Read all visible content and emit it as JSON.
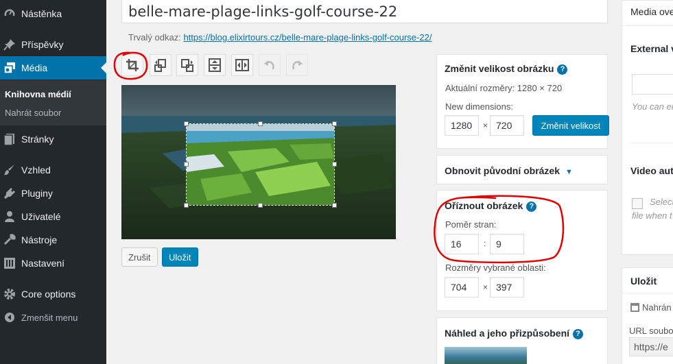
{
  "sidebar": {
    "items": [
      {
        "label": "Nástěnka",
        "icon": "dashboard-icon"
      },
      {
        "label": "Příspěvky",
        "icon": "pin-icon"
      },
      {
        "label": "Média",
        "icon": "media-icon"
      },
      {
        "label": "Stránky",
        "icon": "pages-icon"
      },
      {
        "label": "Vzhled",
        "icon": "appearance-icon"
      },
      {
        "label": "Pluginy",
        "icon": "plugins-icon"
      },
      {
        "label": "Uživatelé",
        "icon": "users-icon"
      },
      {
        "label": "Nástroje",
        "icon": "tools-icon"
      },
      {
        "label": "Nastavení",
        "icon": "settings-icon"
      },
      {
        "label": "Core options",
        "icon": "gear-icon"
      },
      {
        "label": "Zmenšit menu",
        "icon": "collapse-icon"
      }
    ],
    "submenu": [
      {
        "label": "Knihovna médií"
      },
      {
        "label": "Nahrát soubor"
      }
    ]
  },
  "editor": {
    "title": "belle-mare-plage-links-golf-course-22",
    "permalink_label": "Trvalý odkaz:",
    "permalink_url": "https://blog.elixirtours.cz/belle-mare-plage-links-golf-course-22/",
    "toolbar": [
      {
        "name": "crop-button",
        "icon": "crop-icon"
      },
      {
        "name": "rotate-left-button",
        "icon": "rotate-left-icon"
      },
      {
        "name": "rotate-right-button",
        "icon": "rotate-right-icon"
      },
      {
        "name": "flip-vertical-button",
        "icon": "flip-vertical-icon"
      },
      {
        "name": "flip-horizontal-button",
        "icon": "flip-horizontal-icon"
      },
      {
        "name": "undo-button",
        "icon": "undo-icon"
      },
      {
        "name": "redo-button",
        "icon": "redo-icon"
      }
    ],
    "cancel_label": "Zrušit",
    "save_label": "Uložit"
  },
  "scale_panel": {
    "title": "Změnit velikost obrázku",
    "current_dims": "Aktuální rozměry: 1280 × 720",
    "new_dims_label": "New dimensions:",
    "width": "1280",
    "height": "720",
    "times": "×",
    "button_label": "Změnit velikost"
  },
  "restore_panel": {
    "title": "Obnovit původní obrázek"
  },
  "crop_panel": {
    "title": "Oříznout obrázek",
    "ratio_label": "Poměr stran:",
    "ratio_w": "16",
    "ratio_h": "9",
    "colon": ":",
    "selection_label": "Rozměry vybrané oblasti:",
    "sel_w": "704",
    "sel_h": "397",
    "times": "×"
  },
  "thumb_panel": {
    "title": "Náhled a jeho přizpůsobení"
  },
  "right_column": {
    "media_overview": "Media ove",
    "external_label": "External v",
    "you_can": "You can en",
    "video_auto": "Video auto",
    "select_text": "Select",
    "file_when": "file when t",
    "save_title": "Uložit",
    "uploaded": "Nahrán",
    "url_label": "URL soubor",
    "url_value": "https://e"
  },
  "colors": {
    "accent": "#0073aa",
    "primary_button": "#0085ba",
    "sidebar_bg": "#23282d",
    "annotation": "#e00000"
  }
}
